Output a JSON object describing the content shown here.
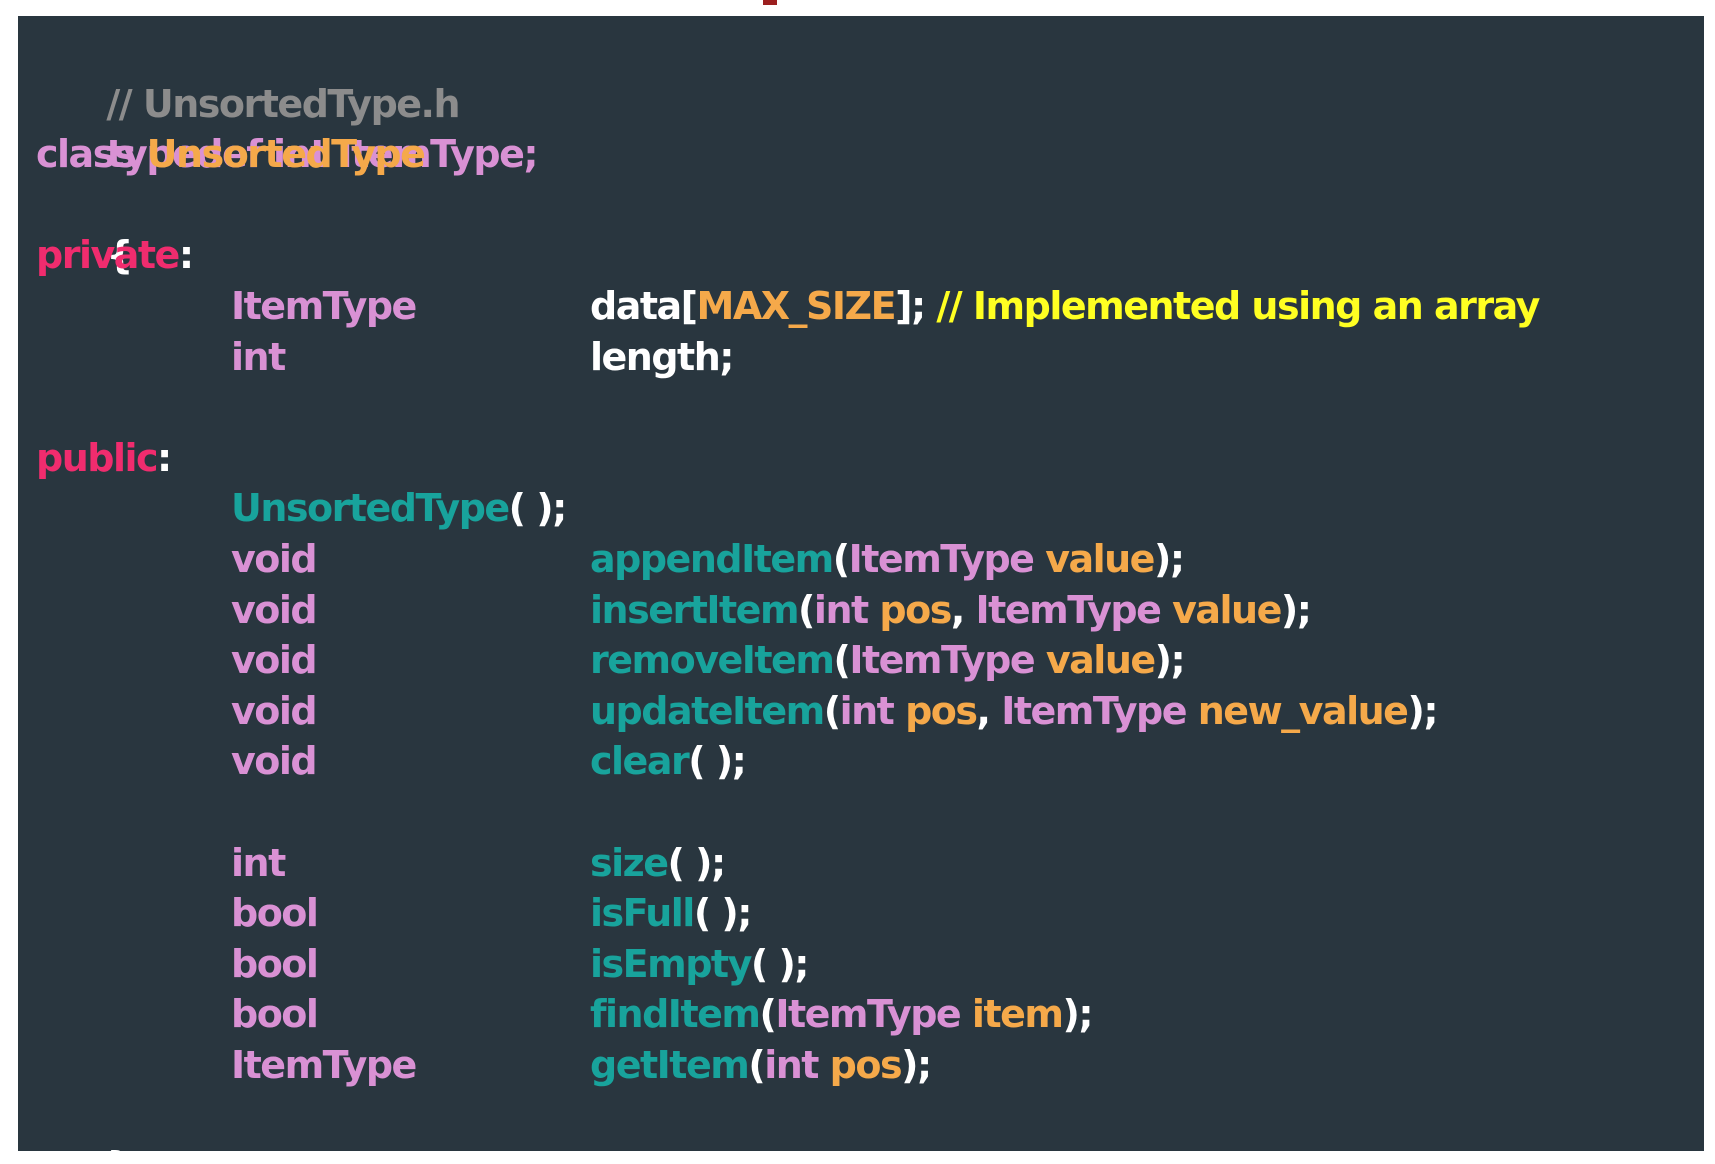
{
  "colors": {
    "background": "#29363f",
    "keyword": "#d991d4",
    "access_specifier": "#f02c6e",
    "class_name": "#f5a94a",
    "function": "#18a39c",
    "parameter": "#f5a94a",
    "punctuation": "#ffffff",
    "file_comment": "#8c8c8c",
    "inline_comment": "#ffff22"
  },
  "code": {
    "file_comment": "// UnsortedType.h",
    "typedef_line": "typedef int ItemType;",
    "class_keyword": "class",
    "class_name": "UnsortedType",
    "open_brace": "{",
    "private_label": "private",
    "colon": ":",
    "members": [
      {
        "type": "ItemType",
        "name": "data",
        "open": "[",
        "size": "MAX_SIZE",
        "close": "];",
        "comment": "// Implemented using an array"
      },
      {
        "type": "int",
        "name": "length;"
      }
    ],
    "public_label": "public",
    "constructor": {
      "name": "UnsortedType",
      "suffix": "( );"
    },
    "methods": [
      {
        "ret": "void",
        "name": "appendItem",
        "p1_type": "ItemType",
        "p1_name": "value",
        "sep": "",
        "p2_type": "",
        "p2_name": "",
        "end": ");"
      },
      {
        "ret": "void",
        "name": "insertItem",
        "p1_type": "int",
        "p1_name": "pos",
        "sep": ",",
        "p2_type": "ItemType",
        "p2_name": "value",
        "end": ");"
      },
      {
        "ret": "void",
        "name": "removeItem",
        "p1_type": "ItemType",
        "p1_name": "value",
        "sep": "",
        "p2_type": "",
        "p2_name": "",
        "end": ");"
      },
      {
        "ret": "void",
        "name": "updateItem",
        "p1_type": "int",
        "p1_name": "pos",
        "sep": ",",
        "p2_type": "ItemType",
        "p2_name": "new_value",
        "end": ");"
      },
      {
        "ret": "void",
        "name": "clear",
        "end": "( );"
      }
    ],
    "queries": [
      {
        "ret": "int",
        "name": "size",
        "end": "( );"
      },
      {
        "ret": "bool",
        "name": "isFull",
        "end": "( );"
      },
      {
        "ret": "bool",
        "name": "isEmpty",
        "end": "( );"
      },
      {
        "ret": "bool",
        "name": "findItem",
        "p1_type": "ItemType",
        "p1_name": "item",
        "end": ");"
      },
      {
        "ret": "ItemType",
        "name": "getItem",
        "p1_type": "int",
        "p1_name": "pos",
        "end": ");"
      }
    ],
    "close_brace": "};"
  }
}
